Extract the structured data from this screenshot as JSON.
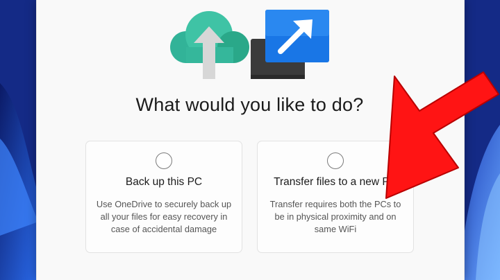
{
  "dialog": {
    "title": "What would you like to do?"
  },
  "options": [
    {
      "label": "Back up this PC",
      "description": "Use OneDrive to securely back up all your files for easy recovery in case of accidental damage",
      "selected": false
    },
    {
      "label": "Transfer files to a new PC",
      "description": "Transfer requires both the PCs to be in physical proximity and on same WiFi",
      "selected": false
    }
  ],
  "icons": {
    "hero_left": "cloud-upload-icon",
    "hero_right": "transfer-arrow-icon",
    "overlay": "red-arrow-pointer"
  },
  "colors": {
    "cloud": "#3fbfa2",
    "blue_tile": "#1a73e8",
    "dark_tile": "#3a3a3a",
    "pointer": "#ff1a1a"
  }
}
